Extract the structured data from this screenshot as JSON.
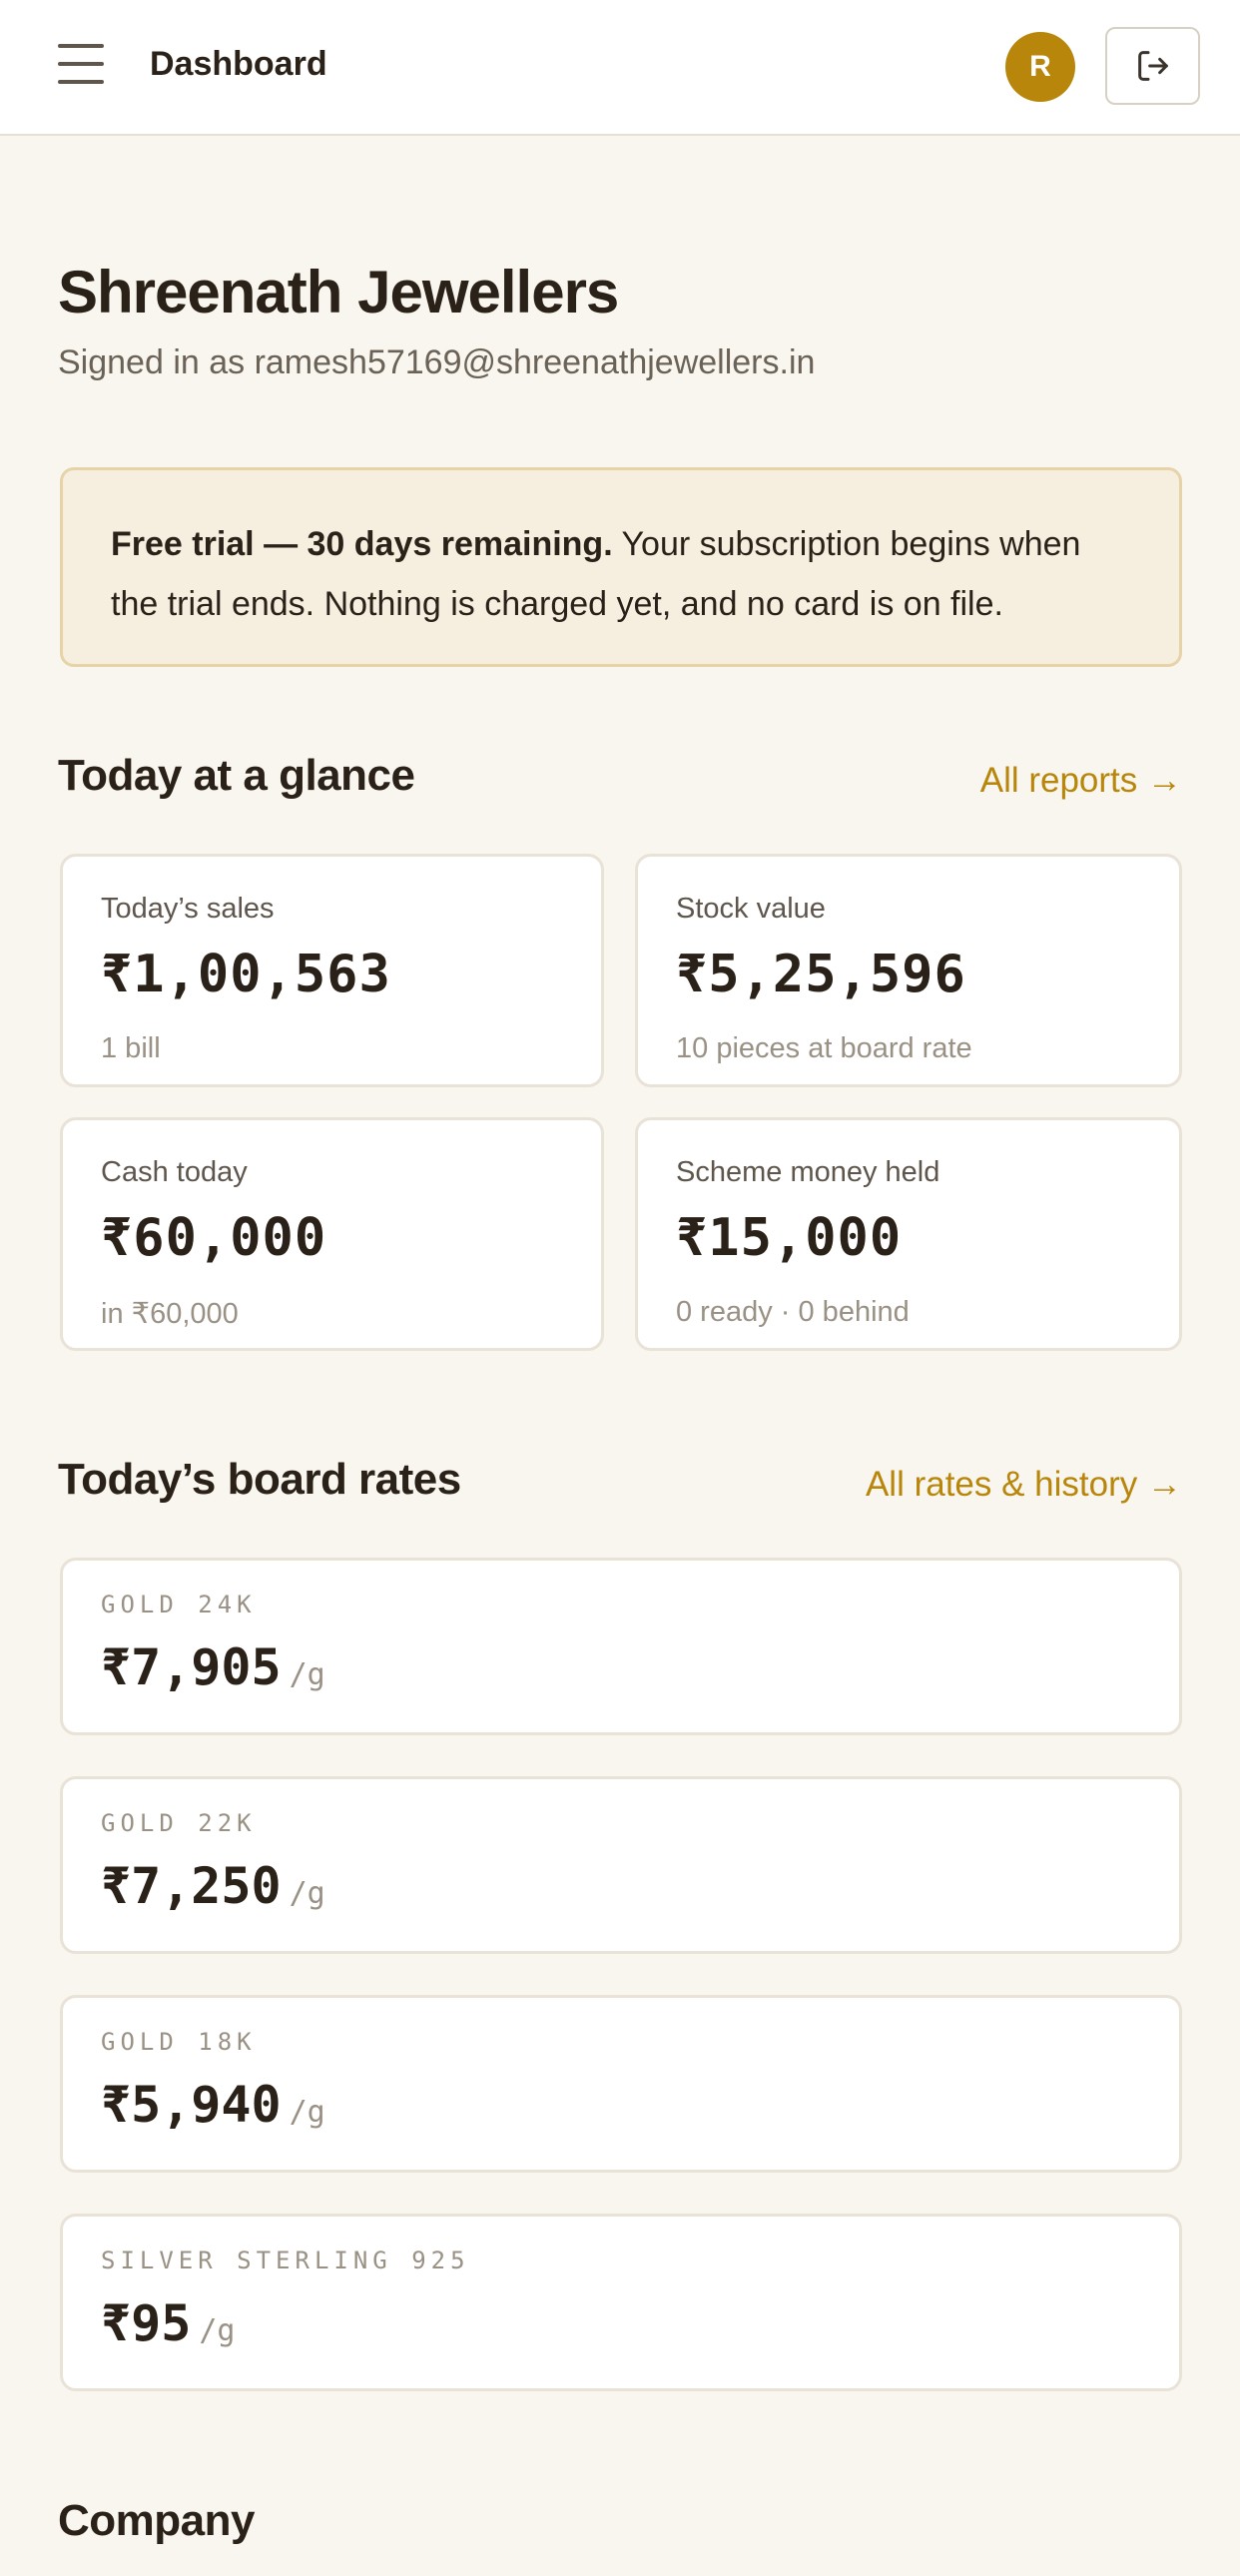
{
  "topbar": {
    "title": "Dashboard",
    "avatar_initial": "R",
    "menu_icon": "menu-icon",
    "logout_icon": "logout-icon"
  },
  "header": {
    "company_name": "Shreenath Jewellers",
    "signed_in": "Signed in as ramesh57169@shreenathjewellers.in"
  },
  "trial": {
    "bold": "Free trial — 30 days remaining.",
    "text": " Your subscription begins when the trial ends. Nothing is charged yet, and no card is on file."
  },
  "glance": {
    "heading": "Today at a glance",
    "link": "All reports →",
    "cards": [
      {
        "label": "Today’s sales",
        "value": "₹1,00,563",
        "sub": "1 bill"
      },
      {
        "label": "Stock value",
        "value": "₹5,25,596",
        "sub": "10 pieces at board rate"
      },
      {
        "label": "Cash today",
        "value": "₹60,000",
        "sub": "in ₹60,000"
      },
      {
        "label": "Scheme money held",
        "value": "₹15,000",
        "sub": "0 ready · 0 behind"
      }
    ]
  },
  "rates": {
    "heading": "Today’s board rates",
    "link": "All rates & history →",
    "items": [
      {
        "label": "GOLD 24K",
        "value": "₹7,905",
        "unit": "/g"
      },
      {
        "label": "GOLD 22K",
        "value": "₹7,250",
        "unit": "/g"
      },
      {
        "label": "GOLD 18K",
        "value": "₹5,940",
        "unit": "/g"
      },
      {
        "label": "SILVER STERLING 925",
        "value": "₹95",
        "unit": "/g"
      }
    ]
  },
  "company": {
    "heading": "Company"
  },
  "colors": {
    "accent": "#b8860b",
    "background": "#f9f6f0",
    "banner_bg": "#f6efe0",
    "banner_border": "#e7d3a8"
  }
}
